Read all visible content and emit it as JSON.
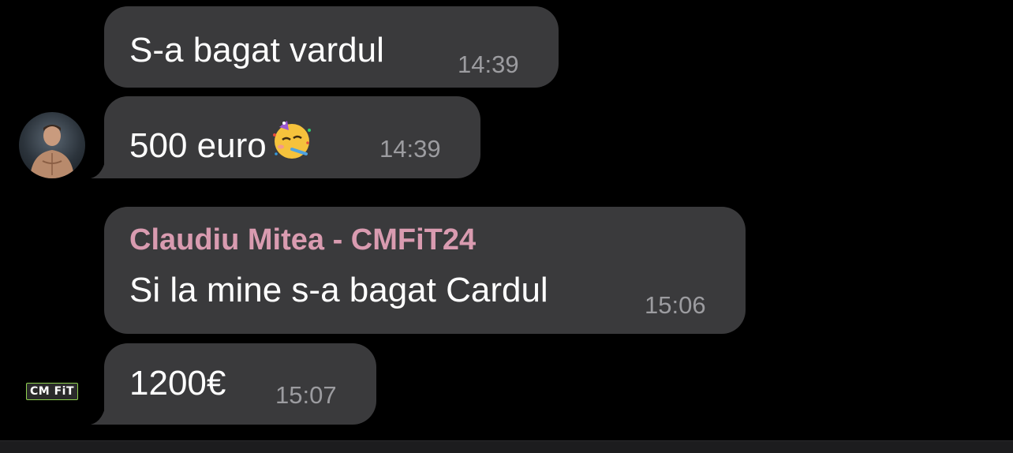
{
  "messages": [
    {
      "text": "S-a bagat vardul",
      "time": "14:39"
    },
    {
      "text": "500 euro",
      "emoji": "partying-face-icon",
      "time": "14:39"
    },
    {
      "sender": "Claudiu Mitea  - CMFiT24",
      "text": "Si la mine s-a bagat Cardul",
      "time": "15:06"
    },
    {
      "text": "1200€",
      "time": "15:07"
    }
  ],
  "avatars": {
    "logo_text": "CM FiT"
  },
  "colors": {
    "background": "#000000",
    "bubble": "#3a3a3c",
    "sender_name": "#d99bb0",
    "timestamp": "#9c9ca0",
    "text": "#ffffff"
  }
}
